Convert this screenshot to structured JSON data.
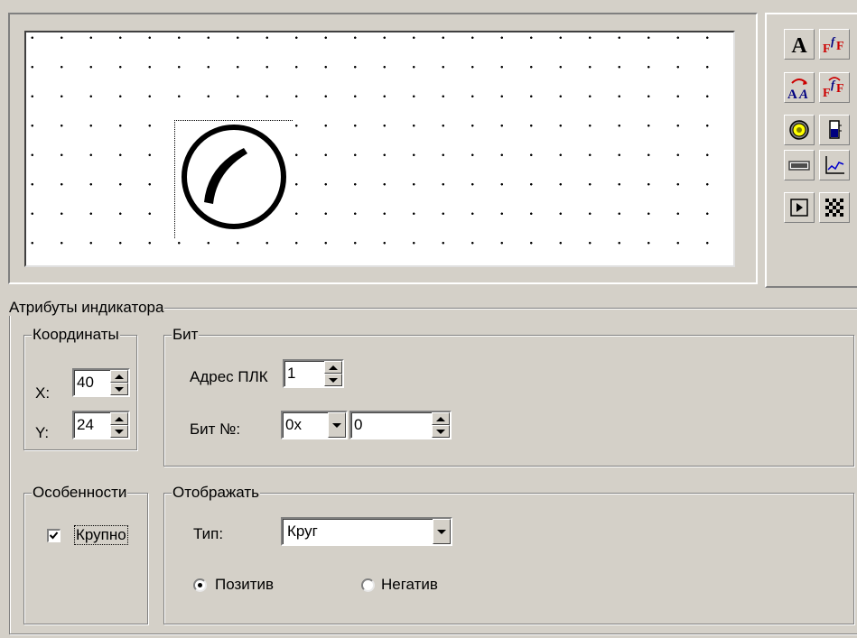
{
  "canvas": {
    "indicator_icon": "round-lamp-icon"
  },
  "toolbar": {
    "buttons": [
      {
        "icon": "text-icon"
      },
      {
        "icon": "font-format-icon"
      },
      {
        "icon": "variable-text-icon"
      },
      {
        "icon": "font-replace-icon"
      },
      {
        "icon": "indicator-lamp-icon"
      },
      {
        "icon": "level-meter-icon"
      },
      {
        "icon": "numeric-display-icon"
      },
      {
        "icon": "trend-chart-icon"
      },
      {
        "icon": "button-control-icon"
      },
      {
        "icon": "bitmap-icon"
      }
    ]
  },
  "attributes": {
    "title": "Атрибуты индикатора",
    "coords": {
      "title": "Координаты",
      "x_label": "X:",
      "x_value": "40",
      "y_label": "Y:",
      "y_value": "24"
    },
    "bit": {
      "title": "Бит",
      "plc_address_label": "Адрес ПЛК",
      "plc_address_value": "1",
      "bit_no_label": "Бит №:",
      "bit_prefix_value": "0x",
      "bit_value": "0"
    },
    "features": {
      "title": "Особенности",
      "large_label": "Крупно",
      "large_checked": true
    },
    "display": {
      "title": "Отображать",
      "type_label": "Тип:",
      "type_value": "Круг",
      "positive_label": "Позитив",
      "negative_label": "Негатив",
      "selected": "positive"
    }
  }
}
